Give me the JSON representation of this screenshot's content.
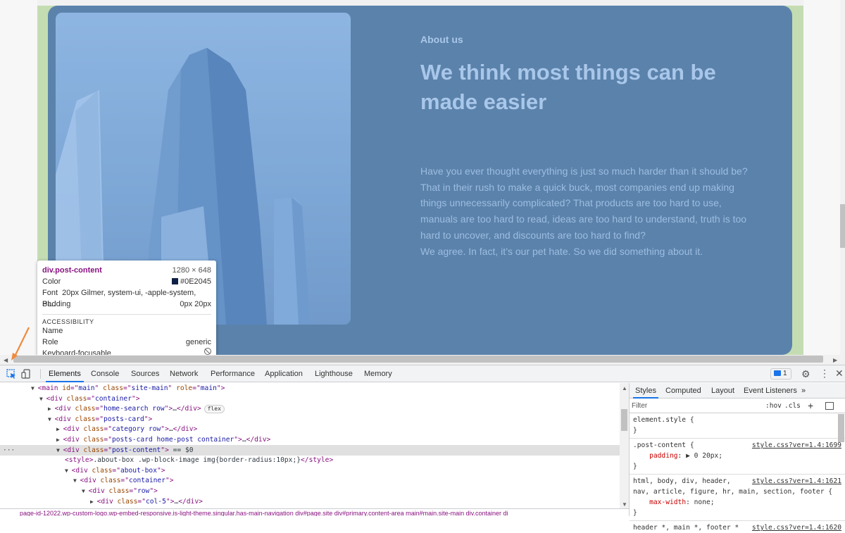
{
  "page": {
    "eyebrow": "About us",
    "heading": "We think most things can be made easier",
    "paragraphs": [
      "Have you ever thought everything is just so much harder than it should be?",
      "That in their rush to make a quick buck, most companies end up making things unnecessarily complicated? That products are too hard to use, manuals are too hard to read, ideas are too hard to understand, truth is too hard to uncover, and discounts are too hard to find?",
      "We agree. In fact, it’s our pet hate. So we did something about it."
    ]
  },
  "tooltip": {
    "selector": "div.post-content",
    "dims": "1280 × 648",
    "color_label": "Color",
    "color_value": "#0E2045",
    "font_label": "Font",
    "font_value": "20px Gilmer, system-ui, -apple-system, Bl...",
    "padding_label": "Padding",
    "padding_value": "0px 20px",
    "accessibility_header": "ACCESSIBILITY",
    "name_label": "Name",
    "role_label": "Role",
    "role_value": "generic",
    "focus_label": "Keyboard-focusable"
  },
  "devtools": {
    "tabs": [
      "Elements",
      "Console",
      "Sources",
      "Network",
      "Performance",
      "Application",
      "Lighthouse",
      "Memory"
    ],
    "issues_count": "1",
    "elements_lines": [
      {
        "indent": 3,
        "tri": "▼",
        "html": [
          [
            "tag",
            "<main "
          ],
          [
            "attr",
            "id"
          ],
          [
            "tag",
            "=\""
          ],
          [
            "val",
            "main"
          ],
          [
            "tag",
            "\" "
          ],
          [
            "attr",
            "class"
          ],
          [
            "tag",
            "=\""
          ],
          [
            "val",
            "site-main"
          ],
          [
            "tag",
            "\" "
          ],
          [
            "attr",
            "role"
          ],
          [
            "tag",
            "=\""
          ],
          [
            "val",
            "main"
          ],
          [
            "tag",
            "\">"
          ]
        ]
      },
      {
        "indent": 4,
        "tri": "▼",
        "html": [
          [
            "tag",
            "<div "
          ],
          [
            "attr",
            "class"
          ],
          [
            "tag",
            "=\""
          ],
          [
            "val",
            "container"
          ],
          [
            "tag",
            "\">"
          ]
        ]
      },
      {
        "indent": 5,
        "tri": "▶",
        "html": [
          [
            "tag",
            "<div "
          ],
          [
            "attr",
            "class"
          ],
          [
            "tag",
            "=\""
          ],
          [
            "val",
            "home-search row"
          ],
          [
            "tag",
            "\">"
          ],
          [
            "txt",
            "…"
          ],
          [
            "tag",
            "</div>"
          ]
        ],
        "badge": "flex"
      },
      {
        "indent": 5,
        "tri": "▼",
        "html": [
          [
            "tag",
            "<div "
          ],
          [
            "attr",
            "class"
          ],
          [
            "tag",
            "=\""
          ],
          [
            "val",
            "posts-card"
          ],
          [
            "tag",
            "\">"
          ]
        ]
      },
      {
        "indent": 6,
        "tri": "▶",
        "html": [
          [
            "tag",
            "<div "
          ],
          [
            "attr",
            "class"
          ],
          [
            "tag",
            "=\""
          ],
          [
            "val",
            "category row"
          ],
          [
            "tag",
            "\">"
          ],
          [
            "txt",
            "…"
          ],
          [
            "tag",
            "</div>"
          ]
        ]
      },
      {
        "indent": 6,
        "tri": "▶",
        "html": [
          [
            "tag",
            "<div "
          ],
          [
            "attr",
            "class"
          ],
          [
            "tag",
            "=\""
          ],
          [
            "val",
            "posts-card  home-post container"
          ],
          [
            "tag",
            "\">"
          ],
          [
            "txt",
            "…"
          ],
          [
            "tag",
            "</div>"
          ]
        ]
      },
      {
        "indent": 6,
        "tri": "▼",
        "html": [
          [
            "tag",
            "<div "
          ],
          [
            "attr",
            "class"
          ],
          [
            "tag",
            "=\""
          ],
          [
            "val",
            "post-content"
          ],
          [
            "tag",
            "\">"
          ],
          [
            "txt",
            " == $0"
          ]
        ],
        "selected": true
      },
      {
        "indent": 7,
        "tri": "",
        "html": [
          [
            "tag",
            "<style>"
          ],
          [
            "txt",
            ".about-box .wp-block-image img{border-radius:10px;}"
          ],
          [
            "tag",
            "</style>"
          ]
        ]
      },
      {
        "indent": 7,
        "tri": "▼",
        "html": [
          [
            "tag",
            "<div "
          ],
          [
            "attr",
            "class"
          ],
          [
            "tag",
            "=\""
          ],
          [
            "val",
            "about-box"
          ],
          [
            "tag",
            "\">"
          ]
        ]
      },
      {
        "indent": 8,
        "tri": "▼",
        "html": [
          [
            "tag",
            "<div "
          ],
          [
            "attr",
            "class"
          ],
          [
            "tag",
            "=\""
          ],
          [
            "val",
            "container"
          ],
          [
            "tag",
            "\">"
          ]
        ]
      },
      {
        "indent": 9,
        "tri": "▼",
        "html": [
          [
            "tag",
            "<div "
          ],
          [
            "attr",
            "class"
          ],
          [
            "tag",
            "=\""
          ],
          [
            "val",
            "row"
          ],
          [
            "tag",
            "\">"
          ]
        ]
      },
      {
        "indent": 10,
        "tri": "▶",
        "html": [
          [
            "tag",
            "<div "
          ],
          [
            "attr",
            "class"
          ],
          [
            "tag",
            "=\""
          ],
          [
            "val",
            "col-5"
          ],
          [
            "tag",
            "\">"
          ],
          [
            "txt",
            "…"
          ],
          [
            "tag",
            "</div>"
          ]
        ]
      }
    ],
    "breadcrumbs": "page-id-12022.wp-custom-logo.wp-embed-responsive.is-light-theme.singular.has-main-navigation   div#page.site   div#primary.content-area   main#main.site-main   div.container   di",
    "styles_tabs": [
      "Styles",
      "Computed",
      "Layout",
      "Event Listeners",
      "»"
    ],
    "filter_placeholder": "Filter",
    "hov": ":hov",
    "cls": ".cls",
    "rules": [
      {
        "lines": [
          "element.style {",
          "}"
        ],
        "src": ""
      },
      {
        "lines": [
          ".post-content {",
          "  padding: ▶ 0 20px;",
          "}"
        ],
        "src": "style.css?ver=1.4:1699"
      },
      {
        "lines": [
          "html, body, div, header,",
          "nav, article, figure, hr, main, section, footer {",
          "  max-width: none;",
          "}"
        ],
        "src": "style.css?ver=1.4:1621"
      },
      {
        "lines": [
          "header *, main *, footer *"
        ],
        "src": "style.css?ver=1.4:1620"
      }
    ]
  }
}
